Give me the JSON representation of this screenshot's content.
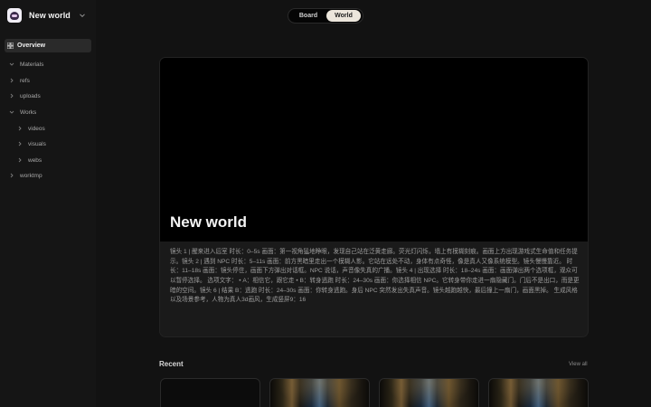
{
  "app": {
    "name": "New world"
  },
  "sidebar": {
    "overview_label": "Overview",
    "items": [
      {
        "label": "Materials",
        "expanded": true,
        "level": 0
      },
      {
        "label": "refs",
        "expanded": false,
        "level": 0
      },
      {
        "label": "uploads",
        "expanded": false,
        "level": 0
      },
      {
        "label": "Works",
        "expanded": true,
        "level": 0
      },
      {
        "label": "videos",
        "expanded": false,
        "level": 1
      },
      {
        "label": "visuals",
        "expanded": false,
        "level": 1
      },
      {
        "label": "webs",
        "expanded": false,
        "level": 1
      },
      {
        "label": "worktmp",
        "expanded": false,
        "level": 0
      }
    ]
  },
  "view_toggle": {
    "board_label": "Board",
    "world_label": "World",
    "active": "World"
  },
  "hero": {
    "title": "New world",
    "description": "镜头 1 | 醒来进入后室 时长：0–5s 画面：第一视角猛地睁眼，发现自己站在泛黄走廊。荧光灯闪烁，墙上有模糊刻痕。画面上方出现游戏式生命值和任务提示。镜头 2 | 遇到 NPC 时长：5–11s 画面：前方黑暗里走出一个模糊人影。它站在远处不动，身体有点奇怪，像是真人又像系统模型。镜头慢慢靠近。 时长：11–18s 画面：镜头停住，画面下方弹出对话框。NPC 说话，声音像失真的广播。镜头 4 | 出现选择 时长：18–24s 画面：画面弹出两个选项框，观众可以暂停选择。 选项文字： • A：相信它，跟它走 • B：转身逃跑 时长：24–30s 画面：你选择相信 NPC。它转身带你走进一扇隐藏门。门后不是出口，而是更暗的空间。镜头 6 | 结果 B：逃跑 时长：24–30s 画面：你转身逃跑。身后 NPC 突然发出失真声音。镜头越跑越快，最后撞上一扇门，画面黑掉。 生成风格以及场景参考，人物为真人3d画风，生成竖屏9：16"
  },
  "recent": {
    "title": "Recent",
    "view_all_label": "View all"
  },
  "colors": {
    "background": "#121212",
    "sidebar": "#151515",
    "active_toggle": "#ece6dc",
    "card": "#1a1a1a"
  }
}
